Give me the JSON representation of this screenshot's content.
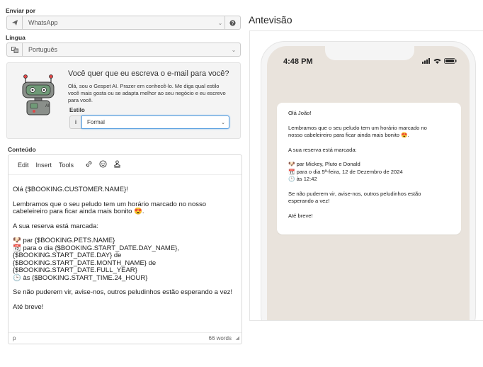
{
  "form": {
    "send_via_label": "Enviar por",
    "send_via_value": "WhatsApp",
    "language_label": "Língua",
    "language_value": "Português"
  },
  "ai": {
    "title": "Você quer que eu escreva o e-mail para você?",
    "description": "Olá, sou o Gespet AI. Prazer em conhecê-lo. Me diga qual estilo você mais gosta ou se adapta melhor ao seu negócio e eu escrevo para você.",
    "style_label": "Estilo",
    "style_value": "Formal",
    "style_prefix": "i"
  },
  "content": {
    "label": "Conteúdo",
    "menu": [
      "Edit",
      "Insert",
      "Tools"
    ],
    "lines": {
      "greeting": "Olá {$BOOKING.CUSTOMER.NAME}!",
      "reminder1": "Lembramos que o seu peludo tem um horário marcado no nosso",
      "reminder2": "cabeleireiro para ficar ainda mais bonito 😍.",
      "booking_intro": "A sua reserva está marcada:",
      "pets": "🐶 par {$BOOKING.PETS.NAME}",
      "date1": "📆 para o dia {$BOOKING.START_DATE.DAY_NAME},",
      "date2": "{$BOOKING.START_DATE.DAY} de",
      "date3": "{$BOOKING.START_DATE.MONTH_NAME} de",
      "date4": "{$BOOKING.START_DATE.FULL_YEAR}",
      "time": "🕒 às {$BOOKING.START_TIME.24_HOUR}",
      "cancel": "Se não puderem vir, avise-nos, outros peludinhos estão esperando a vez!",
      "bye": "Até breve!"
    },
    "status_tag": "p",
    "word_count": "66 words"
  },
  "preview": {
    "title": "Antevisão",
    "time": "4:48 PM",
    "message": {
      "greeting": "Olá João!",
      "reminder1": "Lembramos que o seu peludo tem um horário marcado no",
      "reminder2": "nosso cabeleireiro para ficar ainda mais bonito 😍.",
      "booking_intro": "A sua reserva está marcada:",
      "pets": "🐶 par Mickey, Pluto e Donald",
      "date": "📆 para o dia 5ª-feira, 12 de Dezembro de 2024",
      "time": "🕒 às 12:42",
      "cancel1": "Se não puderem vir, avise-nos, outros peludinhos estão",
      "cancel2": "esperando a vez!",
      "bye": "Até breve!"
    }
  },
  "icons": {
    "send_prefix": "paper-plane-icon",
    "language_prefix": "translate-icon",
    "help": "question-circle-icon",
    "robot": "robot-ai-icon",
    "link": "link-icon",
    "emoji": "emoji-icon",
    "stamp": "stamp-icon"
  },
  "colors": {
    "accent_focus": "#5aa0e0",
    "chat_bg": "#e9e3dc",
    "panel_bg": "#f4f4f4"
  }
}
